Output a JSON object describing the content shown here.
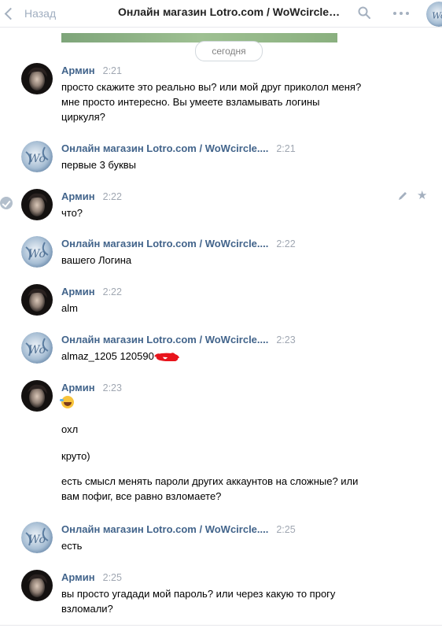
{
  "header": {
    "back_label": "Назад",
    "title": "Онлайн магазин Lotro.com / WoWcircle.com"
  },
  "date_divider": "сегодня",
  "messages": [
    {
      "author": "Армин",
      "time": "2:21",
      "lines": [
        "просто скажите это реально вы? или мой друг приколол меня?",
        "мне просто интересно. Вы умеете взламывать логины",
        "циркуля?"
      ]
    },
    {
      "author": "Онлайн магазин Lotro.com / WoWcircle....",
      "time": "2:21",
      "lines": [
        "первые 3 буквы"
      ]
    },
    {
      "author": "Армин",
      "time": "2:22",
      "lines": [
        "что?"
      ]
    },
    {
      "author": "Онлайн магазин Lotro.com / WoWcircle....",
      "time": "2:22",
      "lines": [
        "вашего Логина"
      ]
    },
    {
      "author": "Армин",
      "time": "2:22",
      "lines": [
        "alm"
      ]
    },
    {
      "author": "Онлайн магазин Lotro.com / WoWcircle....",
      "time": "2:23",
      "lines": [
        "almaz_1205 120590"
      ]
    },
    {
      "author": "Армин",
      "time": "2:23",
      "lines": [
        "охл",
        "круто)",
        "есть смысл менять пароли других аккаунтов на сложные? или",
        "вам пофиг, все равно взломаете?"
      ]
    },
    {
      "author": "Онлайн магазин Lotro.com / WoWcircle....",
      "time": "2:25",
      "lines": [
        "есть"
      ]
    },
    {
      "author": "Армин",
      "time": "2:25",
      "lines": [
        "вы просто угадади мой пароль? или через какую то прогу",
        "взломали?"
      ]
    }
  ],
  "icons": {
    "back": "chevron-left-icon",
    "search": "search-icon",
    "more": "more-horizontal-icon",
    "selected": "check-circle-icon",
    "edit": "pencil-icon",
    "favorite": "star-icon",
    "emoji": "rolling-laughing-emoji-icon"
  },
  "colors": {
    "name": "#42648b",
    "time": "#a0a7b2",
    "muted": "#a4b0bf",
    "redaction": "#e8141c"
  }
}
